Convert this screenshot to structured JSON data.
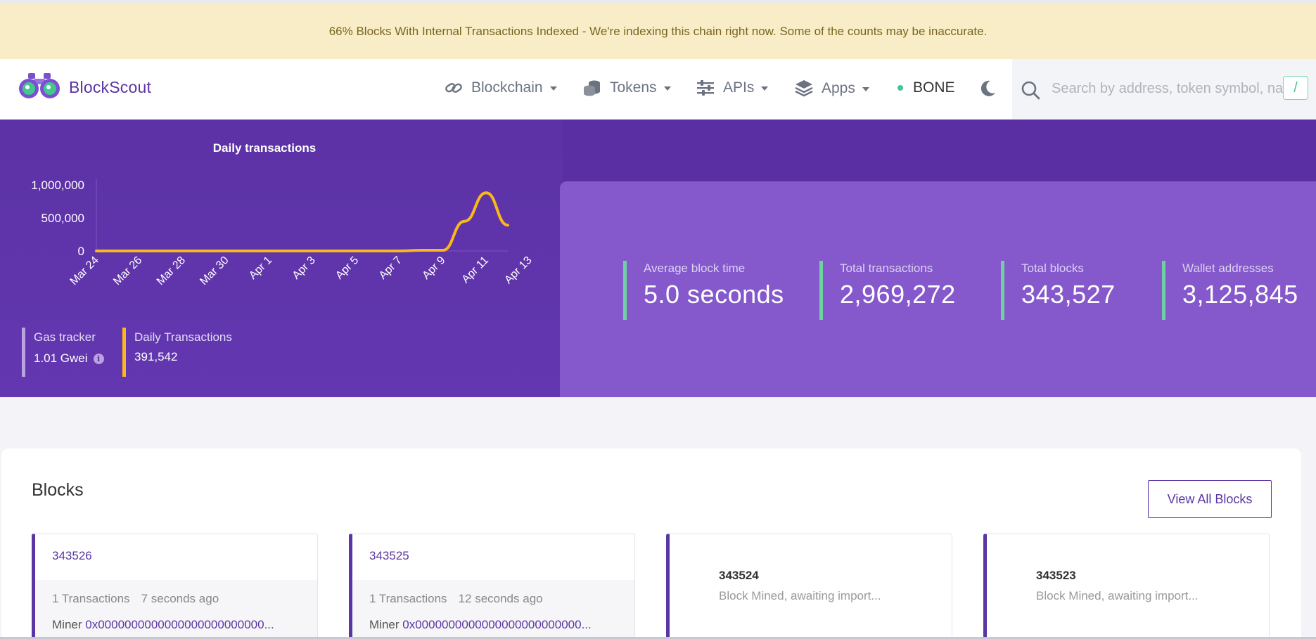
{
  "banner": {
    "text": "66% Blocks With Internal Transactions Indexed - We're indexing this chain right now. Some of the counts may be inaccurate."
  },
  "brand": {
    "name": "BlockScout",
    "icon": "binoculars-icon"
  },
  "nav": {
    "items": [
      {
        "label": "Blockchain",
        "icon": "link-icon"
      },
      {
        "label": "Tokens",
        "icon": "coins-icon"
      },
      {
        "label": "APIs",
        "icon": "sliders-icon"
      },
      {
        "label": "Apps",
        "icon": "layers-icon"
      }
    ],
    "network": "BONE",
    "theme_toggle_icon": "moon-icon"
  },
  "search": {
    "placeholder": "Search by address, token symbol, name, transaction hash, or block number",
    "shortcut": "/"
  },
  "chart_data": {
    "type": "line",
    "title": "Daily transactions",
    "x": [
      "Mar 24",
      "Mar 25",
      "Mar 26",
      "Mar 27",
      "Mar 28",
      "Mar 29",
      "Mar 30",
      "Mar 31",
      "Apr 1",
      "Apr 2",
      "Apr 3",
      "Apr 4",
      "Apr 5",
      "Apr 6",
      "Apr 7",
      "Apr 8",
      "Apr 9",
      "Apr 10",
      "Apr 11",
      "Apr 12"
    ],
    "values": [
      0,
      0,
      0,
      0,
      0,
      0,
      0,
      0,
      0,
      0,
      0,
      0,
      0,
      0,
      0,
      10000,
      10000,
      450000,
      880000,
      390000
    ],
    "xticks": [
      "Mar 24",
      "Mar 26",
      "Mar 28",
      "Mar 30",
      "Apr 1",
      "Apr 3",
      "Apr 5",
      "Apr 7",
      "Apr 9",
      "Apr 11",
      "Apr 13"
    ],
    "yticks": [
      "0",
      "500,000",
      "1,000,000"
    ],
    "ylim": [
      0,
      1000000
    ],
    "line_color": "#f9b81b"
  },
  "gas_tracker": {
    "label": "Gas tracker",
    "value": "1.01 Gwei",
    "color": "#b9a3e0"
  },
  "daily_tx": {
    "label": "Daily Transactions",
    "value": "391,542",
    "color": "#f9b81b"
  },
  "stats": [
    {
      "label": "Average block time",
      "value": "5.0 seconds"
    },
    {
      "label": "Total transactions",
      "value": "2,969,272"
    },
    {
      "label": "Total blocks",
      "value": "343,527"
    },
    {
      "label": "Wallet addresses",
      "value": "3,125,845"
    }
  ],
  "blocks": {
    "title": "Blocks",
    "view_all": "View All Blocks",
    "items": [
      {
        "number": "343526",
        "transactions": "1 Transactions",
        "age": "7 seconds ago",
        "miner_label": "Miner",
        "miner": "0x0000000000000000000000000..."
      },
      {
        "number": "343525",
        "transactions": "1 Transactions",
        "age": "12 seconds ago",
        "miner_label": "Miner",
        "miner": "0x0000000000000000000000000..."
      },
      {
        "number": "343524",
        "status": "Block Mined, awaiting import..."
      },
      {
        "number": "343523",
        "status": "Block Mined, awaiting import..."
      }
    ]
  },
  "colors": {
    "accent": "#5b35a4",
    "hero": "#5d32a6",
    "stats_panel": "#8558cc",
    "stat_bar": "#6fd1a2",
    "banner": "#f8edc6"
  }
}
